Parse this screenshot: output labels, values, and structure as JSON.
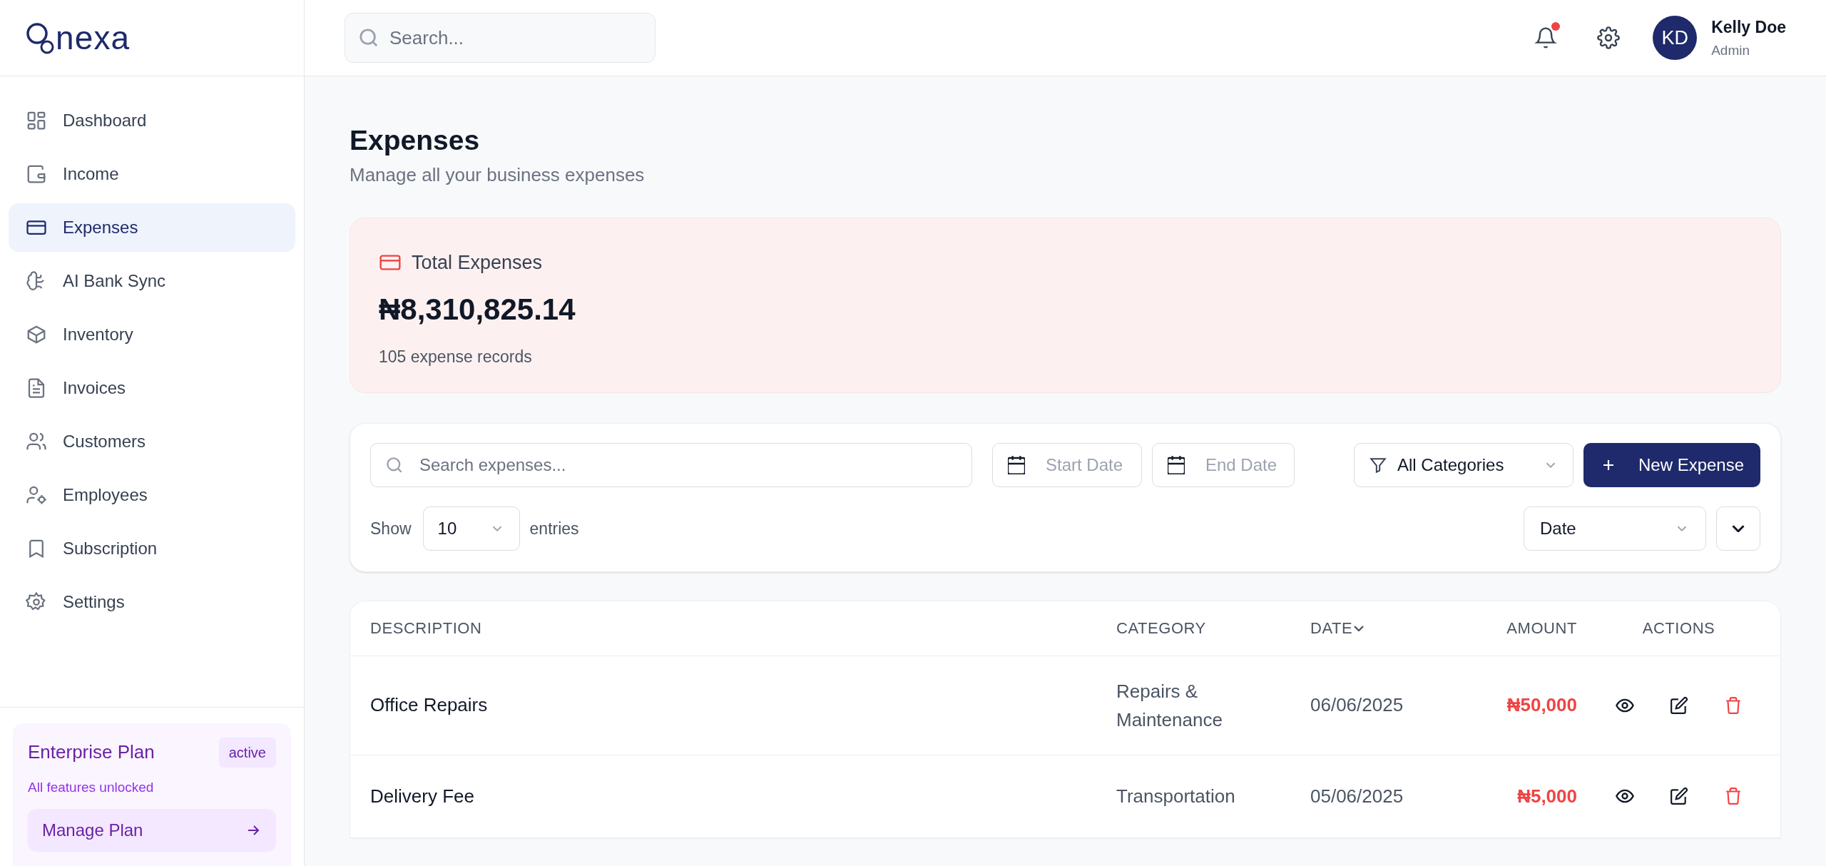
{
  "logo": {
    "text": "nexa"
  },
  "sidebar": {
    "items": [
      {
        "label": "Dashboard",
        "selected": false
      },
      {
        "label": "Income",
        "selected": false
      },
      {
        "label": "Expenses",
        "selected": true
      },
      {
        "label": "AI Bank Sync",
        "selected": false
      },
      {
        "label": "Inventory",
        "selected": false
      },
      {
        "label": "Invoices",
        "selected": false
      },
      {
        "label": "Customers",
        "selected": false
      },
      {
        "label": "Employees",
        "selected": false
      },
      {
        "label": "Subscription",
        "selected": false
      },
      {
        "label": "Settings",
        "selected": false
      }
    ],
    "plan": {
      "name": "Enterprise Plan",
      "badge": "active",
      "note": "All features unlocked",
      "button": "Manage Plan"
    }
  },
  "header": {
    "search": {
      "placeholder": "Search..."
    },
    "notifications": {
      "unread": true
    },
    "user": {
      "initials": "KD",
      "name": "Kelly Doe",
      "role": "Admin"
    }
  },
  "page": {
    "title": "Expenses",
    "subtitle": "Manage all your business expenses"
  },
  "summary": {
    "label": "Total Expenses",
    "amount": "₦8,310,825.14",
    "records": "105 expense records"
  },
  "filters": {
    "search": {
      "placeholder": "Search expenses..."
    },
    "start_date": {
      "placeholder": "Start Date"
    },
    "end_date": {
      "placeholder": "End Date"
    },
    "category": "All Categories",
    "new_button": "New Expense",
    "show_label": "Show",
    "page_size": "10",
    "entries_label": "entries",
    "sort_by": "Date"
  },
  "table": {
    "columns": [
      {
        "label": "DESCRIPTION",
        "sorted": false
      },
      {
        "label": "CATEGORY",
        "sorted": false
      },
      {
        "label": "DATE",
        "sorted": true
      },
      {
        "label": "AMOUNT",
        "sorted": false
      },
      {
        "label": "ACTIONS",
        "sorted": false
      }
    ],
    "rows": [
      {
        "description": "Office Repairs",
        "category": "Repairs & Maintenance",
        "date": "06/06/2025",
        "amount": "₦50,000"
      },
      {
        "description": "Delivery Fee",
        "category": "Transportation",
        "date": "05/06/2025",
        "amount": "₦5,000"
      }
    ]
  }
}
